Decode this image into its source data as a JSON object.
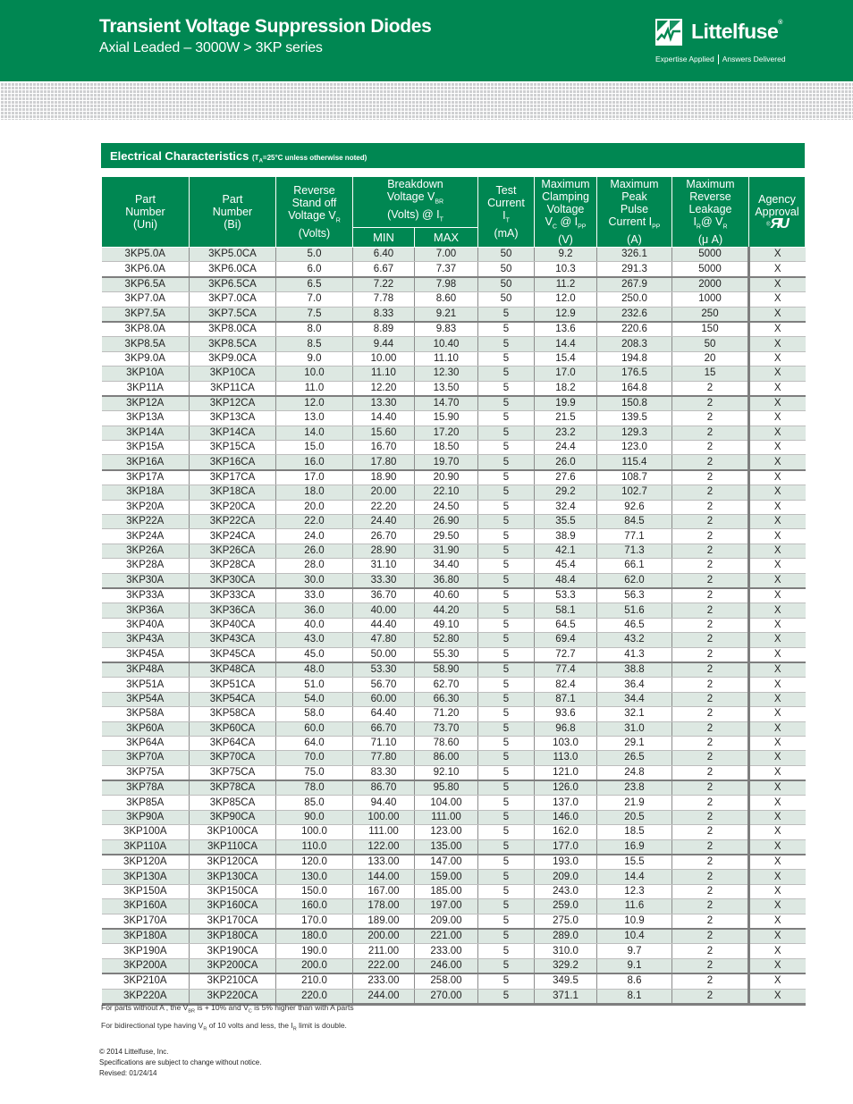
{
  "header": {
    "title": "Transient Voltage Suppression Diodes",
    "subtitle": "Axial Leaded – 3000W  >  3KP series",
    "brand": "Littelfuse",
    "brand_reg": "®",
    "tagline_left": "Expertise Applied",
    "tagline_right": "Answers Delivered",
    "brand_color": "#008752"
  },
  "section": {
    "title": "Electrical Characteristics",
    "note_prefix": "(T",
    "note_sub": "A",
    "note_suffix": "=25°C unless otherwise noted)"
  },
  "table": {
    "columns": {
      "uni": [
        "Part",
        "Number",
        "(Uni)"
      ],
      "bi": [
        "Part",
        "Number",
        "(Bi)"
      ],
      "vr": {
        "l1": "Reverse",
        "l2": "Stand off",
        "l3": "Voltage V",
        "l3sub": "R",
        "l4": "(Volts)"
      },
      "vbr": {
        "l1": "Breakdown",
        "l2": "Voltage V",
        "l2sub": "BR",
        "l3": "(Volts)  @ I",
        "l3sub": "T",
        "min": "MIN",
        "max": "MAX"
      },
      "it": {
        "l1": "Test",
        "l2": "Current",
        "l3": "I",
        "l3sub": "T",
        "l4": "(mA)"
      },
      "vc": {
        "l1": "Maximum",
        "l2": "Clamping",
        "l3": "Voltage",
        "l4a": "V",
        "l4asub": "C",
        "l4b": " @ I",
        "l4bsub": "PP",
        "l5": "(V)"
      },
      "ipp": {
        "l1": "Maximum",
        "l2": "Peak",
        "l3": "Pulse",
        "l4": "Current I",
        "l4sub": "PP",
        "l5": "(A)"
      },
      "ir": {
        "l1": "Maximum",
        "l2": "Reverse",
        "l3": "Leakage",
        "l4a": "I",
        "l4asub": "R",
        "l4b": "@ V",
        "l4bsub": "R",
        "l5": "(μ A)"
      },
      "agency": {
        "l1": "Agency",
        "l2": "Approval",
        "icon": "ul-recognized-icon",
        "mark": "ЯU",
        "reg": "®"
      }
    },
    "rows": [
      [
        "3KP5.0A",
        "3KP5.0CA",
        "5.0",
        "6.40",
        "7.00",
        "50",
        "9.2",
        "326.1",
        "5000",
        "X"
      ],
      [
        "3KP6.0A",
        "3KP6.0CA",
        "6.0",
        "6.67",
        "7.37",
        "50",
        "10.3",
        "291.3",
        "5000",
        "X"
      ],
      [
        "3KP6.5A",
        "3KP6.5CA",
        "6.5",
        "7.22",
        "7.98",
        "50",
        "11.2",
        "267.9",
        "2000",
        "X"
      ],
      [
        "3KP7.0A",
        "3KP7.0CA",
        "7.0",
        "7.78",
        "8.60",
        "50",
        "12.0",
        "250.0",
        "1000",
        "X"
      ],
      [
        "3KP7.5A",
        "3KP7.5CA",
        "7.5",
        "8.33",
        "9.21",
        "5",
        "12.9",
        "232.6",
        "250",
        "X"
      ],
      [
        "3KP8.0A",
        "3KP8.0CA",
        "8.0",
        "8.89",
        "9.83",
        "5",
        "13.6",
        "220.6",
        "150",
        "X"
      ],
      [
        "3KP8.5A",
        "3KP8.5CA",
        "8.5",
        "9.44",
        "10.40",
        "5",
        "14.4",
        "208.3",
        "50",
        "X"
      ],
      [
        "3KP9.0A",
        "3KP9.0CA",
        "9.0",
        "10.00",
        "11.10",
        "5",
        "15.4",
        "194.8",
        "20",
        "X"
      ],
      [
        "3KP10A",
        "3KP10CA",
        "10.0",
        "11.10",
        "12.30",
        "5",
        "17.0",
        "176.5",
        "15",
        "X"
      ],
      [
        "3KP11A",
        "3KP11CA",
        "11.0",
        "12.20",
        "13.50",
        "5",
        "18.2",
        "164.8",
        "2",
        "X"
      ],
      [
        "3KP12A",
        "3KP12CA",
        "12.0",
        "13.30",
        "14.70",
        "5",
        "19.9",
        "150.8",
        "2",
        "X"
      ],
      [
        "3KP13A",
        "3KP13CA",
        "13.0",
        "14.40",
        "15.90",
        "5",
        "21.5",
        "139.5",
        "2",
        "X"
      ],
      [
        "3KP14A",
        "3KP14CA",
        "14.0",
        "15.60",
        "17.20",
        "5",
        "23.2",
        "129.3",
        "2",
        "X"
      ],
      [
        "3KP15A",
        "3KP15CA",
        "15.0",
        "16.70",
        "18.50",
        "5",
        "24.4",
        "123.0",
        "2",
        "X"
      ],
      [
        "3KP16A",
        "3KP16CA",
        "16.0",
        "17.80",
        "19.70",
        "5",
        "26.0",
        "115.4",
        "2",
        "X"
      ],
      [
        "3KP17A",
        "3KP17CA",
        "17.0",
        "18.90",
        "20.90",
        "5",
        "27.6",
        "108.7",
        "2",
        "X"
      ],
      [
        "3KP18A",
        "3KP18CA",
        "18.0",
        "20.00",
        "22.10",
        "5",
        "29.2",
        "102.7",
        "2",
        "X"
      ],
      [
        "3KP20A",
        "3KP20CA",
        "20.0",
        "22.20",
        "24.50",
        "5",
        "32.4",
        "92.6",
        "2",
        "X"
      ],
      [
        "3KP22A",
        "3KP22CA",
        "22.0",
        "24.40",
        "26.90",
        "5",
        "35.5",
        "84.5",
        "2",
        "X"
      ],
      [
        "3KP24A",
        "3KP24CA",
        "24.0",
        "26.70",
        "29.50",
        "5",
        "38.9",
        "77.1",
        "2",
        "X"
      ],
      [
        "3KP26A",
        "3KP26CA",
        "26.0",
        "28.90",
        "31.90",
        "5",
        "42.1",
        "71.3",
        "2",
        "X"
      ],
      [
        "3KP28A",
        "3KP28CA",
        "28.0",
        "31.10",
        "34.40",
        "5",
        "45.4",
        "66.1",
        "2",
        "X"
      ],
      [
        "3KP30A",
        "3KP30CA",
        "30.0",
        "33.30",
        "36.80",
        "5",
        "48.4",
        "62.0",
        "2",
        "X"
      ],
      [
        "3KP33A",
        "3KP33CA",
        "33.0",
        "36.70",
        "40.60",
        "5",
        "53.3",
        "56.3",
        "2",
        "X"
      ],
      [
        "3KP36A",
        "3KP36CA",
        "36.0",
        "40.00",
        "44.20",
        "5",
        "58.1",
        "51.6",
        "2",
        "X"
      ],
      [
        "3KP40A",
        "3KP40CA",
        "40.0",
        "44.40",
        "49.10",
        "5",
        "64.5",
        "46.5",
        "2",
        "X"
      ],
      [
        "3KP43A",
        "3KP43CA",
        "43.0",
        "47.80",
        "52.80",
        "5",
        "69.4",
        "43.2",
        "2",
        "X"
      ],
      [
        "3KP45A",
        "3KP45CA",
        "45.0",
        "50.00",
        "55.30",
        "5",
        "72.7",
        "41.3",
        "2",
        "X"
      ],
      [
        "3KP48A",
        "3KP48CA",
        "48.0",
        "53.30",
        "58.90",
        "5",
        "77.4",
        "38.8",
        "2",
        "X"
      ],
      [
        "3KP51A",
        "3KP51CA",
        "51.0",
        "56.70",
        "62.70",
        "5",
        "82.4",
        "36.4",
        "2",
        "X"
      ],
      [
        "3KP54A",
        "3KP54CA",
        "54.0",
        "60.00",
        "66.30",
        "5",
        "87.1",
        "34.4",
        "2",
        "X"
      ],
      [
        "3KP58A",
        "3KP58CA",
        "58.0",
        "64.40",
        "71.20",
        "5",
        "93.6",
        "32.1",
        "2",
        "X"
      ],
      [
        "3KP60A",
        "3KP60CA",
        "60.0",
        "66.70",
        "73.70",
        "5",
        "96.8",
        "31.0",
        "2",
        "X"
      ],
      [
        "3KP64A",
        "3KP64CA",
        "64.0",
        "71.10",
        "78.60",
        "5",
        "103.0",
        "29.1",
        "2",
        "X"
      ],
      [
        "3KP70A",
        "3KP70CA",
        "70.0",
        "77.80",
        "86.00",
        "5",
        "113.0",
        "26.5",
        "2",
        "X"
      ],
      [
        "3KP75A",
        "3KP75CA",
        "75.0",
        "83.30",
        "92.10",
        "5",
        "121.0",
        "24.8",
        "2",
        "X"
      ],
      [
        "3KP78A",
        "3KP78CA",
        "78.0",
        "86.70",
        "95.80",
        "5",
        "126.0",
        "23.8",
        "2",
        "X"
      ],
      [
        "3KP85A",
        "3KP85CA",
        "85.0",
        "94.40",
        "104.00",
        "5",
        "137.0",
        "21.9",
        "2",
        "X"
      ],
      [
        "3KP90A",
        "3KP90CA",
        "90.0",
        "100.00",
        "111.00",
        "5",
        "146.0",
        "20.5",
        "2",
        "X"
      ],
      [
        "3KP100A",
        "3KP100CA",
        "100.0",
        "111.00",
        "123.00",
        "5",
        "162.0",
        "18.5",
        "2",
        "X"
      ],
      [
        "3KP110A",
        "3KP110CA",
        "110.0",
        "122.00",
        "135.00",
        "5",
        "177.0",
        "16.9",
        "2",
        "X"
      ],
      [
        "3KP120A",
        "3KP120CA",
        "120.0",
        "133.00",
        "147.00",
        "5",
        "193.0",
        "15.5",
        "2",
        "X"
      ],
      [
        "3KP130A",
        "3KP130CA",
        "130.0",
        "144.00",
        "159.00",
        "5",
        "209.0",
        "14.4",
        "2",
        "X"
      ],
      [
        "3KP150A",
        "3KP150CA",
        "150.0",
        "167.00",
        "185.00",
        "5",
        "243.0",
        "12.3",
        "2",
        "X"
      ],
      [
        "3KP160A",
        "3KP160CA",
        "160.0",
        "178.00",
        "197.00",
        "5",
        "259.0",
        "11.6",
        "2",
        "X"
      ],
      [
        "3KP170A",
        "3KP170CA",
        "170.0",
        "189.00",
        "209.00",
        "5",
        "275.0",
        "10.9",
        "2",
        "X"
      ],
      [
        "3KP180A",
        "3KP180CA",
        "180.0",
        "200.00",
        "221.00",
        "5",
        "289.0",
        "10.4",
        "2",
        "X"
      ],
      [
        "3KP190A",
        "3KP190CA",
        "190.0",
        "211.00",
        "233.00",
        "5",
        "310.0",
        "9.7",
        "2",
        "X"
      ],
      [
        "3KP200A",
        "3KP200CA",
        "200.0",
        "222.00",
        "246.00",
        "5",
        "329.2",
        "9.1",
        "2",
        "X"
      ],
      [
        "3KP210A",
        "3KP210CA",
        "210.0",
        "233.00",
        "258.00",
        "5",
        "349.5",
        "8.6",
        "2",
        "X"
      ],
      [
        "3KP220A",
        "3KP220CA",
        "220.0",
        "244.00",
        "270.00",
        "5",
        "371.1",
        "8.1",
        "2",
        "X"
      ]
    ],
    "group_breaks_after": [
      "3KP6.0A",
      "3KP7.5A",
      "3KP11A",
      "3KP16A",
      "3KP30A",
      "3KP45A",
      "3KP75A",
      "3KP110A",
      "3KP170A",
      "3KP200A"
    ]
  },
  "notes": {
    "n1": {
      "a": "For parts without A , the V",
      "asub": "BR",
      "b": " is + 10% and V",
      "bsub": "C",
      "c": " is 5% higher than with A parts"
    },
    "n2": {
      "a": "For bidirectional type having V",
      "asub": "R",
      "b": " of 10 volts and less, the I",
      "bsub": "R",
      "c": " limit is double."
    }
  },
  "footer": {
    "copyright": "© 2014 Littelfuse, Inc.",
    "disclaimer": "Specifications are subject to change without notice.",
    "revised": "Revised: 01/24/14"
  }
}
